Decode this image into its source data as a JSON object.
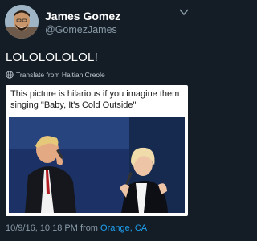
{
  "user": {
    "display_name": "James Gomez",
    "handle": "@GomezJames"
  },
  "tweet": {
    "text": "LOLOLOLOLOL!",
    "translate_label": "Translate from Haitian Creole",
    "timestamp": "10/9/16, 10:18 PM",
    "from_label": "from",
    "location": "Orange, CA"
  },
  "card": {
    "caption": "This picture is hilarious if you imagine them singing \"Baby, It's Cold Outside\""
  },
  "colors": {
    "background": "#141d26",
    "secondary_text": "#8899a6",
    "link": "#1da1f2"
  },
  "icons": [
    "avatar",
    "chevron-down-icon",
    "globe-icon"
  ]
}
